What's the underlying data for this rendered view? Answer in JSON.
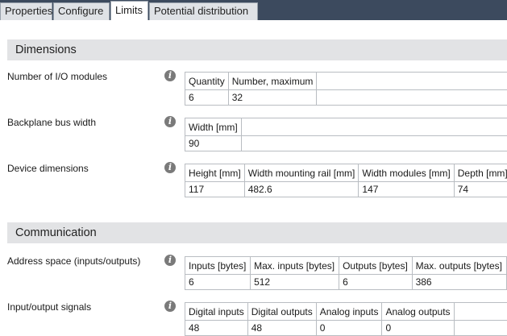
{
  "tabs": [
    {
      "label": "Properties"
    },
    {
      "label": "Configure"
    },
    {
      "label": "Limits"
    },
    {
      "label": "Potential distribution"
    }
  ],
  "sections": {
    "dimensions": {
      "title": "Dimensions"
    },
    "communication": {
      "title": "Communication"
    }
  },
  "rows": {
    "io_modules": {
      "label": "Number of I/O modules",
      "headers": [
        "Quantity",
        "Number, maximum"
      ],
      "values": [
        "6",
        "32"
      ]
    },
    "backplane": {
      "label": "Backplane bus width",
      "headers": [
        "Width [mm]"
      ],
      "values": [
        "90"
      ]
    },
    "device_dims": {
      "label": "Device dimensions",
      "headers": [
        "Height [mm]",
        "Width mounting rail [mm]",
        "Width modules [mm]",
        "Depth [mm]"
      ],
      "values": [
        "117",
        "482.6",
        "147",
        "74"
      ]
    },
    "address_space": {
      "label": "Address space (inputs/outputs)",
      "headers": [
        "Inputs [bytes]",
        "Max. inputs [bytes]",
        "Outputs [bytes]",
        "Max. outputs [bytes]"
      ],
      "values": [
        "6",
        "512",
        "6",
        "386"
      ]
    },
    "io_signals": {
      "label": "Input/output signals",
      "headers": [
        "Digital inputs",
        "Digital outputs",
        "Analog inputs",
        "Analog outputs"
      ],
      "values": [
        "48",
        "48",
        "0",
        "0"
      ]
    }
  },
  "icons": {
    "info": "info-icon",
    "info_glyph": "i"
  },
  "colors": {
    "tabbar": "#3c4a5e",
    "section_header": "#e2e3e5",
    "grid_border": "#b9bdc2",
    "info_icon": "#7a7a7a"
  }
}
